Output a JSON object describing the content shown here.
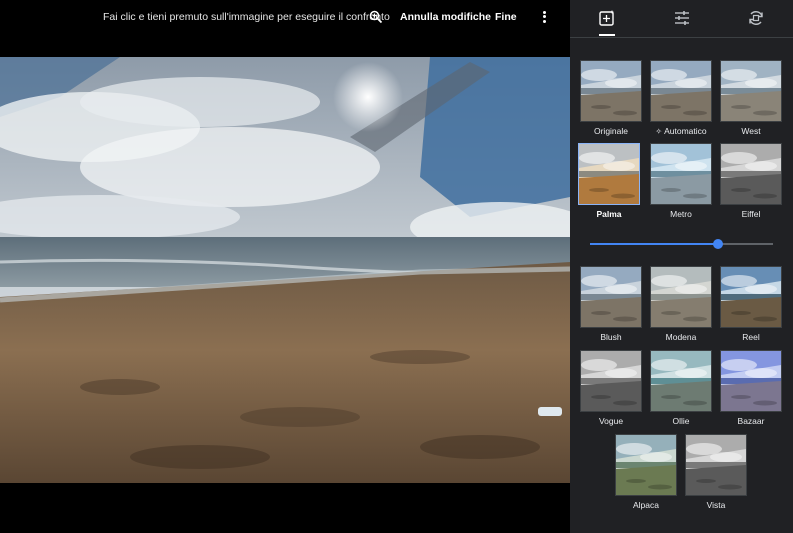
{
  "topbar": {
    "hint": "Fai clic e tieni premuto sull'immagine per eseguire il confronto",
    "undo_label": "Annulla modifiche",
    "done_label": "Fine"
  },
  "panel": {
    "filters": [
      {
        "label": "Originale",
        "tone": "natural"
      },
      {
        "label": "Automatico",
        "tone": "natural",
        "icon": "sparkle-icon"
      },
      {
        "label": "West",
        "tone": "cool"
      },
      {
        "label": "Palma",
        "tone": "warm",
        "selected": true
      },
      {
        "label": "Metro",
        "tone": "cold"
      },
      {
        "label": "Eiffel",
        "tone": "mono"
      },
      {
        "label": "Blush",
        "tone": "natural"
      },
      {
        "label": "Modena",
        "tone": "faded"
      },
      {
        "label": "Reel",
        "tone": "contrast"
      },
      {
        "label": "Vogue",
        "tone": "mono"
      },
      {
        "label": "Ollie",
        "tone": "teal"
      },
      {
        "label": "Bazaar",
        "tone": "blue"
      },
      {
        "label": "Alpaca",
        "tone": "green"
      },
      {
        "label": "Vista",
        "tone": "mono"
      }
    ],
    "intensity": 0.7
  },
  "colors": {
    "accent": "#4285f4",
    "panel_bg": "#202124",
    "selected_border": "#8ab4f8"
  }
}
